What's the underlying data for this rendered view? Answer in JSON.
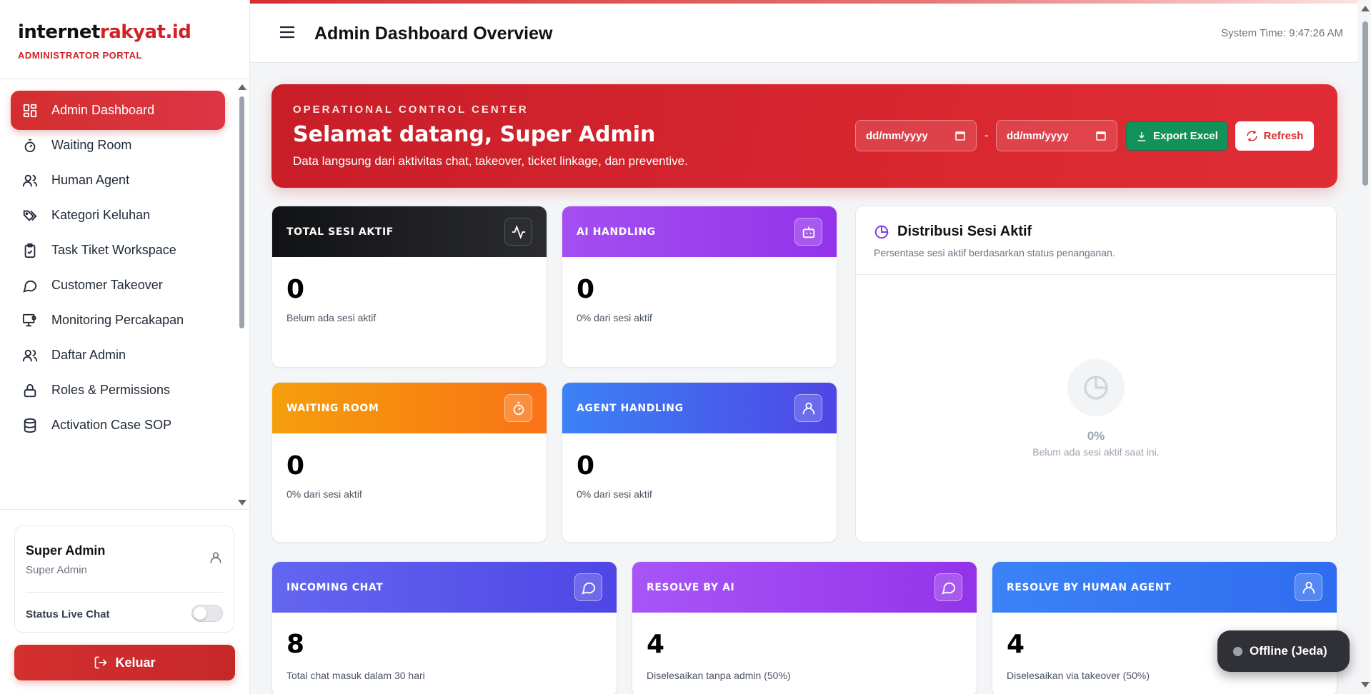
{
  "brand": {
    "name_part1": "internet",
    "name_part2": "rakyat.id",
    "subtitle": "ADMINISTRATOR PORTAL"
  },
  "sidebar": {
    "items": [
      {
        "label": "Admin Dashboard",
        "icon": "dashboard-icon",
        "active": true
      },
      {
        "label": "Waiting Room",
        "icon": "timer-icon"
      },
      {
        "label": "Human Agent",
        "icon": "users-icon"
      },
      {
        "label": "Kategori Keluhan",
        "icon": "tags-icon"
      },
      {
        "label": "Task Tiket Workspace",
        "icon": "clipboard-check-icon"
      },
      {
        "label": "Customer Takeover",
        "icon": "chat-bubble-icon"
      },
      {
        "label": "Monitoring Percakapan",
        "icon": "monitor-user-icon"
      },
      {
        "label": "Daftar Admin",
        "icon": "users-icon"
      },
      {
        "label": "Roles & Permissions",
        "icon": "lock-icon"
      },
      {
        "label": "Activation Case SOP",
        "icon": "database-icon"
      }
    ]
  },
  "user": {
    "name": "Super Admin",
    "role": "Super Admin",
    "live_chat_label": "Status Live Chat",
    "live_chat_on": false
  },
  "logout_label": "Keluar",
  "header": {
    "title": "Admin Dashboard Overview",
    "system_time": "System Time: 9:47:26 AM"
  },
  "hero": {
    "kicker": "OPERATIONAL CONTROL CENTER",
    "title": "Selamat datang, Super Admin",
    "description": "Data langsung dari aktivitas chat, takeover, ticket linkage, dan preventive.",
    "date_from_placeholder": "dd/mm/yyyy",
    "date_to_placeholder": "dd/mm/yyyy",
    "date_separator": "-",
    "export_label": "Export Excel",
    "refresh_label": "Refresh"
  },
  "stats": {
    "total_sesi": {
      "label": "TOTAL SESI AKTIF",
      "value": "0",
      "sub": "Belum ada sesi aktif"
    },
    "ai_handling": {
      "label": "AI HANDLING",
      "value": "0",
      "sub": "0% dari sesi aktif"
    },
    "waiting_room": {
      "label": "WAITING ROOM",
      "value": "0",
      "sub": "0% dari sesi aktif"
    },
    "agent_handling": {
      "label": "AGENT HANDLING",
      "value": "0",
      "sub": "0% dari sesi aktif"
    },
    "incoming_chat": {
      "label": "INCOMING CHAT",
      "value": "8",
      "sub": "Total chat masuk dalam 30 hari"
    },
    "resolve_ai": {
      "label": "RESOLVE BY AI",
      "value": "4",
      "sub": "Diselesaikan tanpa admin (50%)"
    },
    "resolve_human": {
      "label": "RESOLVE BY HUMAN AGENT",
      "value": "4",
      "sub": "Diselesaikan via takeover (50%)"
    }
  },
  "distribution": {
    "title": "Distribusi Sesi Aktif",
    "subtitle": "Persentase sesi aktif berdasarkan status penanganan.",
    "percent": "0%",
    "empty_message": "Belum ada sesi aktif saat ini."
  },
  "status_pill": {
    "label": "Offline (Jeda)"
  },
  "colors": {
    "brand_red": "#d32027",
    "export_green": "#12915a"
  }
}
